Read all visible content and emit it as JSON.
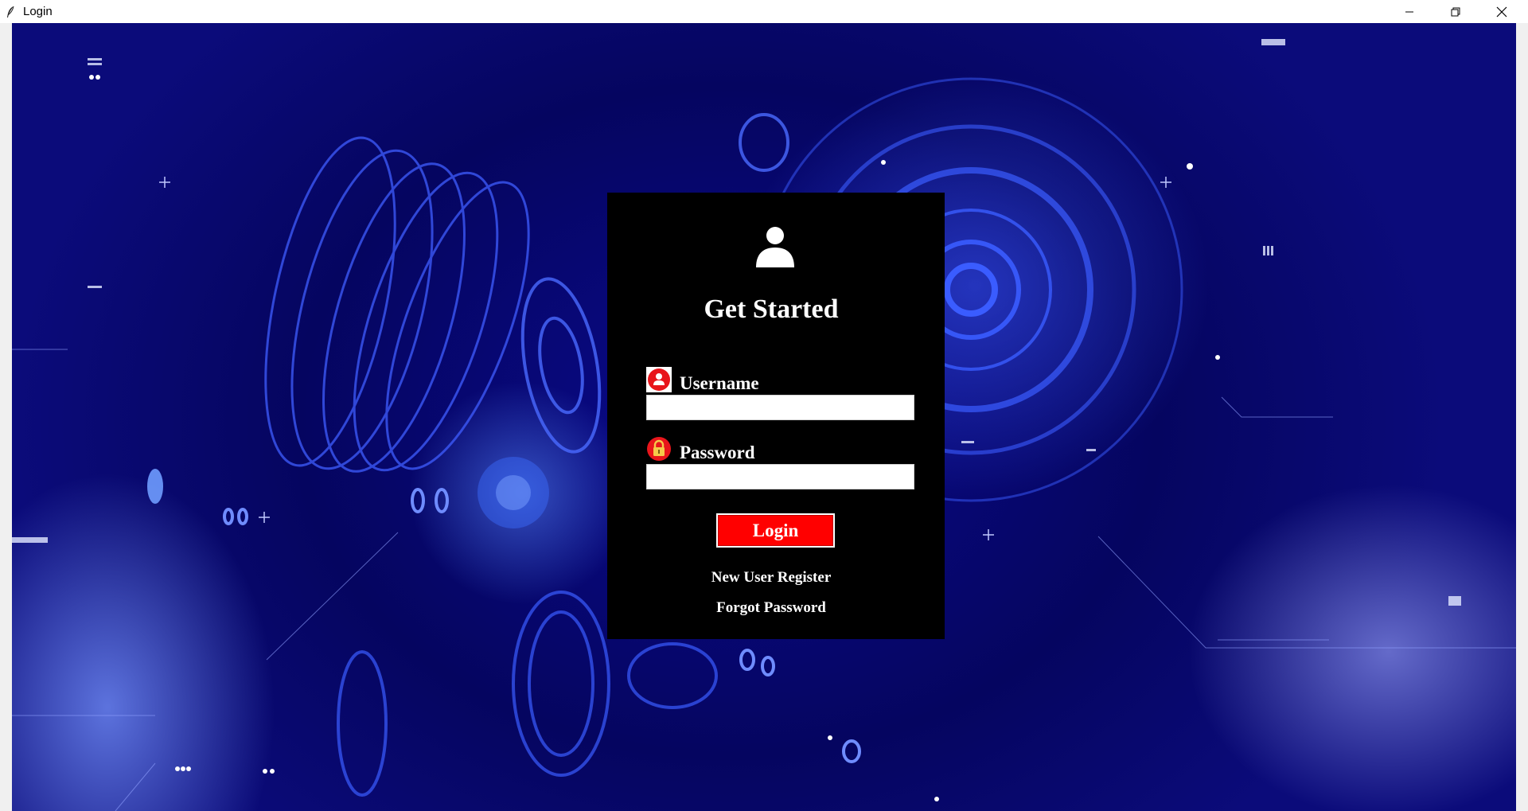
{
  "window": {
    "title": "Login"
  },
  "login": {
    "heading": "Get Started",
    "username_label": "Username",
    "username_value": "",
    "password_label": "Password",
    "password_value": "",
    "login_button": "Login",
    "register_link": "New User Register",
    "forgot_link": "Forgot Password"
  },
  "icons": {
    "app": "feather-icon",
    "avatar": "user-avatar-icon",
    "username": "user-circle-icon",
    "password": "lock-icon",
    "minimize": "minimize-icon",
    "maximize": "restore-icon",
    "close": "close-icon"
  },
  "colors": {
    "panel": "#000000",
    "accent": "#ff0000",
    "text": "#ffffff",
    "background": "#07076a"
  }
}
